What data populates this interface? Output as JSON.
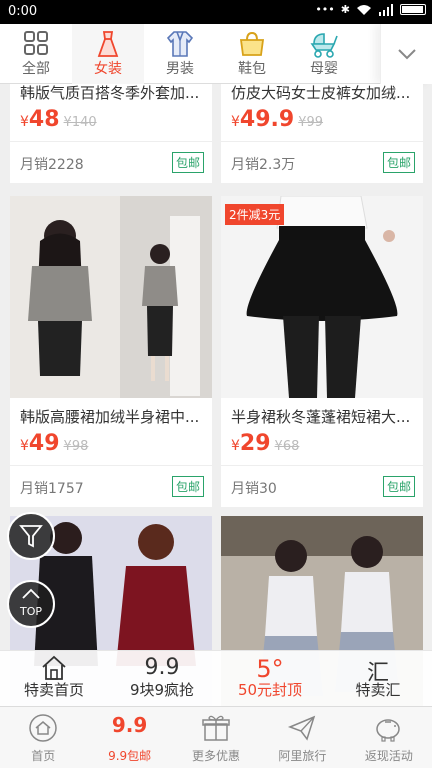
{
  "status": {
    "time": "0:00"
  },
  "categories": [
    {
      "label": "全部",
      "icon": "grid-icon",
      "active": false
    },
    {
      "label": "女装",
      "icon": "dress-icon",
      "active": true
    },
    {
      "label": "男装",
      "icon": "suit-icon",
      "active": false
    },
    {
      "label": "鞋包",
      "icon": "handbag-icon",
      "active": false
    },
    {
      "label": "母婴",
      "icon": "stroller-icon",
      "active": false
    }
  ],
  "products": [
    {
      "title": "韩版气质百搭冬季外套加...",
      "currency": "¥",
      "price": "48",
      "old_price": "¥140",
      "sales": "月销2228",
      "tag": "包邮"
    },
    {
      "title": "仿皮大码女士皮裤女加绒...",
      "currency": "¥",
      "price": "49.9",
      "old_price": "¥99",
      "sales": "月销2.3万",
      "tag": "包邮"
    },
    {
      "title": "韩版高腰裙加绒半身裙中...",
      "currency": "¥",
      "price": "49",
      "old_price": "¥98",
      "sales": "月销1757",
      "tag": "包邮"
    },
    {
      "title": "半身裙秋冬蓬蓬裙短裙大...",
      "currency": "¥",
      "price": "29",
      "old_price": "¥68",
      "sales": "月销30",
      "tag": "包邮",
      "promo": "2件减3元"
    }
  ],
  "fab": {
    "top_label": "TOP"
  },
  "subnav": [
    {
      "label": "特卖首页",
      "icon": "home-icon"
    },
    {
      "label": "9块9疯抢",
      "glyph": "9.9",
      "icon": "nine-nine-icon"
    },
    {
      "label": "50元封顶",
      "glyph": "5°",
      "icon": "fifty-icon",
      "highlight": true
    },
    {
      "label": "特卖汇",
      "glyph": "汇",
      "icon": "hui-icon"
    }
  ],
  "bottomnav": [
    {
      "label": "首页",
      "icon": "home-circle-icon"
    },
    {
      "label": "9.9包邮",
      "glyph": "9.9",
      "icon": "nine-nine-icon",
      "active": true
    },
    {
      "label": "更多优惠",
      "icon": "gift-icon"
    },
    {
      "label": "阿里旅行",
      "icon": "paper-plane-icon"
    },
    {
      "label": "返现活动",
      "icon": "piggy-bank-icon"
    }
  ],
  "colors": {
    "accent": "#f0462d",
    "tag_green": "#2aa36a"
  }
}
